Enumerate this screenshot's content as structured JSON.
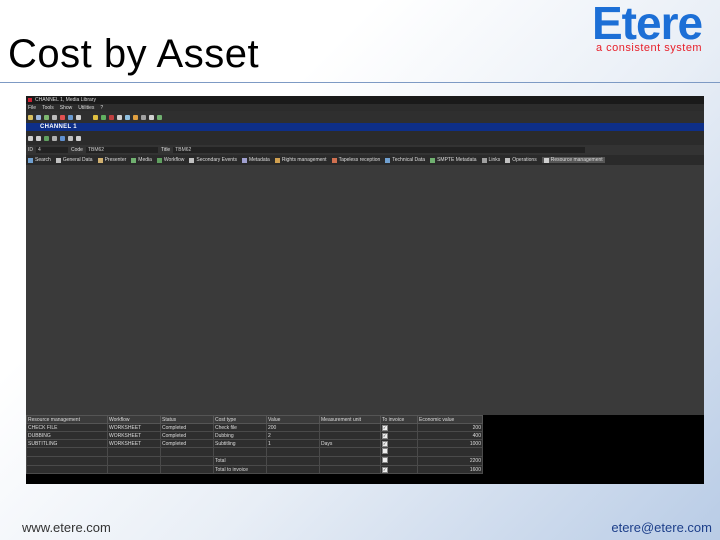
{
  "slide": {
    "title": "Cost by Asset",
    "logo_word": "Etere",
    "logo_tagline": "a consistent system",
    "footer_left": "www.etere.com",
    "footer_right": "etere@etere.com"
  },
  "app": {
    "window_title": "CHANNEL 1, Media Library",
    "menu": [
      "File",
      "Tools",
      "Show",
      "Utilities",
      "?"
    ],
    "channel": "CHANNEL 1",
    "id_fields": [
      {
        "label": "ID",
        "value": "4"
      },
      {
        "label": "Code",
        "value": "TBM62"
      },
      {
        "label": "Title",
        "value": "TBM62"
      }
    ],
    "tabs": [
      {
        "label": "Search",
        "active": false
      },
      {
        "label": "General Data",
        "active": false
      },
      {
        "label": "Presenter",
        "active": false
      },
      {
        "label": "Media",
        "active": false
      },
      {
        "label": "Workflow",
        "active": false
      },
      {
        "label": "Secondary Events",
        "active": false
      },
      {
        "label": "Metadata",
        "active": false
      },
      {
        "label": "Rights management",
        "active": false
      },
      {
        "label": "Tapeless reception",
        "active": false
      },
      {
        "label": "Technical Data",
        "active": false
      },
      {
        "label": "SMPTE Metadata",
        "active": false
      },
      {
        "label": "Links",
        "active": false
      },
      {
        "label": "Operations",
        "active": false
      },
      {
        "label": "Resource management",
        "active": true
      }
    ],
    "colors": {
      "channel_bar": "#0e2f88",
      "logo_blue": "#1c6fd6",
      "logo_red": "#e8202a"
    },
    "grid": {
      "columns": [
        "Resource management",
        "Workflow",
        "Status",
        "Cost type",
        "Value",
        "Measurement unit",
        "To invoice",
        "Economic value"
      ],
      "rows": [
        [
          "CHECK FILE",
          "WORKSHEET",
          "Completed",
          "Check file",
          "200",
          "",
          "checked",
          "200"
        ],
        [
          "DUBBING",
          "WORKSHEET",
          "Completed",
          "Dubbing",
          "2",
          "",
          "checked",
          "400"
        ],
        [
          "SUBTITLING",
          "WORKSHEET",
          "Completed",
          "Subtitling",
          "1",
          "Days",
          "checked",
          "1000"
        ],
        [
          "",
          "",
          "",
          "",
          "",
          "",
          "unchecked",
          ""
        ],
        [
          "",
          "",
          "",
          "Total",
          "",
          "",
          "unchecked",
          "2200"
        ],
        [
          "",
          "",
          "",
          "Total to invoice",
          "",
          "",
          "checked",
          "1600"
        ]
      ]
    }
  }
}
